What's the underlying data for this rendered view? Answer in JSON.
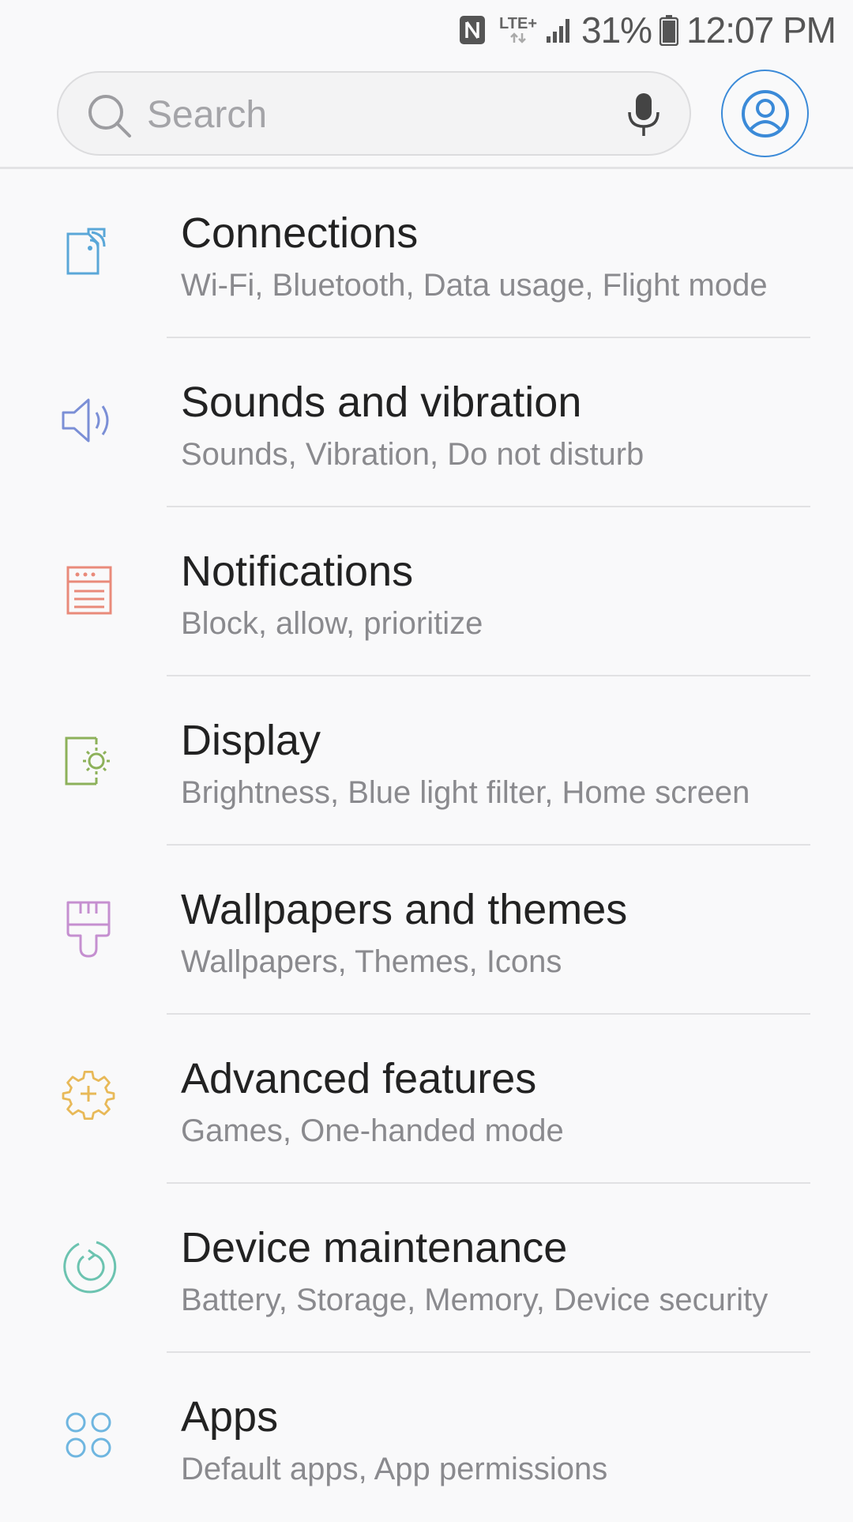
{
  "status_bar": {
    "network_type": "LTE+",
    "battery_percent": "31%",
    "time": "12:07 PM",
    "icons": [
      "nfc-icon",
      "lte-data-icon",
      "signal-icon",
      "battery-icon"
    ]
  },
  "search": {
    "placeholder": "Search",
    "value": "",
    "icons": [
      "search-icon",
      "mic-icon"
    ]
  },
  "profile": {
    "icon": "account-icon",
    "accent_color": "#3b8ad8"
  },
  "settings": {
    "items": [
      {
        "title": "Connections",
        "subtitle": "Wi-Fi, Bluetooth, Data usage, Flight mode",
        "icon": "connections-icon",
        "color": "#5aa7d8"
      },
      {
        "title": "Sounds and vibration",
        "subtitle": "Sounds, Vibration, Do not disturb",
        "icon": "speaker-icon",
        "color": "#7b8fd6"
      },
      {
        "title": "Notifications",
        "subtitle": "Block, allow, prioritize",
        "icon": "notifications-icon",
        "color": "#e98a7a"
      },
      {
        "title": "Display",
        "subtitle": "Brightness, Blue light filter, Home screen",
        "icon": "display-icon",
        "color": "#8db15a"
      },
      {
        "title": "Wallpapers and themes",
        "subtitle": "Wallpapers, Themes, Icons",
        "icon": "paintbrush-icon",
        "color": "#c58fd0"
      },
      {
        "title": "Advanced features",
        "subtitle": "Games, One-handed mode",
        "icon": "gear-plus-icon",
        "color": "#e8b958"
      },
      {
        "title": "Device maintenance",
        "subtitle": "Battery, Storage, Memory, Device security",
        "icon": "maintenance-icon",
        "color": "#6cc3b0"
      },
      {
        "title": "Apps",
        "subtitle": "Default apps, App permissions",
        "icon": "apps-icon",
        "color": "#6fb6e0"
      }
    ]
  }
}
